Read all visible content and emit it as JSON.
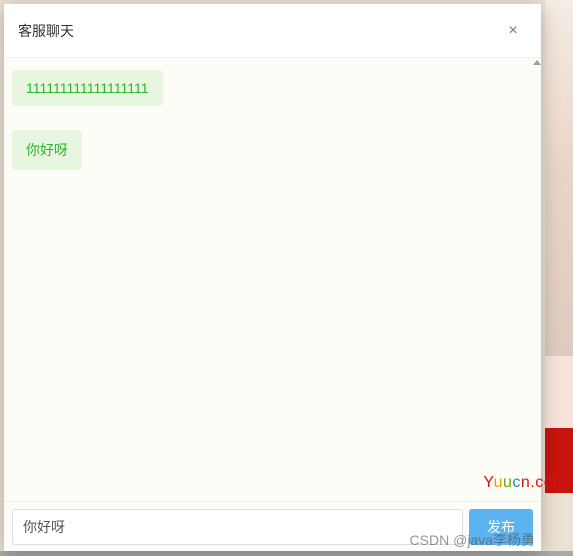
{
  "modal": {
    "title": "客服聊天",
    "close_icon": "×"
  },
  "chat": {
    "messages": [
      {
        "text": "111111111111111111"
      },
      {
        "text": "你好呀"
      }
    ]
  },
  "input": {
    "value": "你好呀",
    "placeholder": ""
  },
  "buttons": {
    "send": "发布"
  },
  "watermarks": {
    "site": "Yuucn.com",
    "csdn": "CSDN @java李杨勇"
  }
}
